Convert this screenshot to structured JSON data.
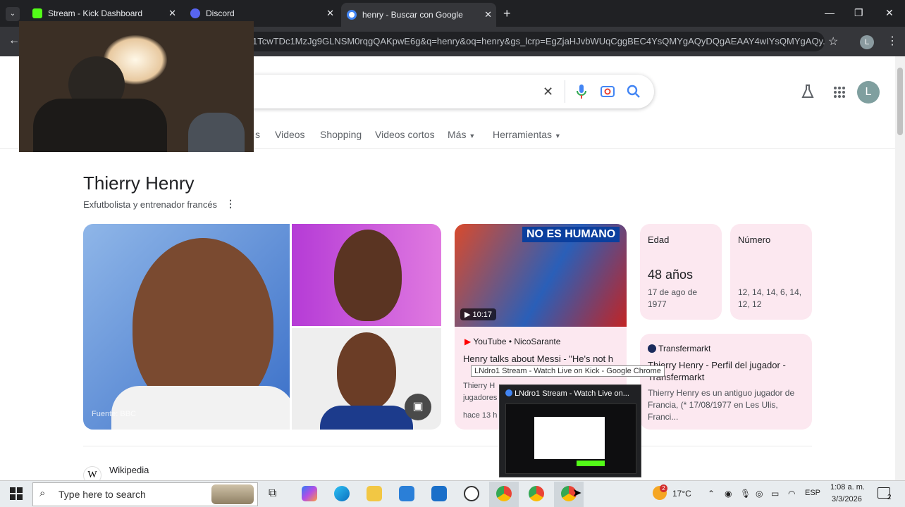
{
  "browser": {
    "tabs": [
      {
        "title": "Stream - Kick Dashboard",
        "favicon": "kick-icon",
        "color": "#53fc18"
      },
      {
        "title": "Discord",
        "favicon": "discord-icon",
        "color": "#5865f2"
      },
      {
        "title": "henry - Buscar con Google",
        "favicon": "google-icon",
        "color": "#ffffff"
      }
    ],
    "new_tab": "+",
    "close_glyph": "✕",
    "url": "1TcwTDc1MzJg9GLNSM0rqgQAKpwE6g&q=henry&oq=henry&gs_lcrp=EgZjaHJvbWUqCggBEC4YsQMYgAQyDQgAEAAY4wIYsQMYgAQy...",
    "profile_initial": "L",
    "window_controls": {
      "minimize": "—",
      "restore": "❐",
      "close": "✕"
    }
  },
  "search": {
    "close": "✕",
    "tabs": [
      "s",
      "Videos",
      "Shopping",
      "Videos cortos",
      "Más",
      "Herramientas"
    ],
    "profile_initial": "L"
  },
  "knowledge_panel": {
    "title": "Thierry Henry",
    "subtitle": "Exfutbolista y entrenador francés",
    "image_source": "Fuente: BBC",
    "video": {
      "thumbnail_text": "NO ES HUMANO",
      "duration": "10:17",
      "source": "YouTube • NicoSarante",
      "title": "Henry talks about Messi - \"He's not h",
      "snippet_1": "Thierry H",
      "snippet_2": "jugadores",
      "age": "hace 13 h"
    },
    "facts": [
      {
        "label": "Edad",
        "value": "48 años",
        "detail": "17 de ago de 1977"
      },
      {
        "label": "Número",
        "detail": "12, 14, 14, 6, 14, 12, 12"
      }
    ],
    "transfermarkt": {
      "source": "Transfermarkt",
      "title": "Thierry Henry - Perfil del jugador - Transfermarkt",
      "snippet": "Thierry Henry es un antiguo jugador de Francia, (* 17/08/1977 en Les Ulis, Franci..."
    },
    "wiki": {
      "source": "Wikipedia"
    }
  },
  "overlay": {
    "tooltip": "LNdro1 Stream - Watch Live on Kick - Google Chrome",
    "popup_title": "LNdro1 Stream - Watch Live on..."
  },
  "taskbar": {
    "search_placeholder": "Type here to search",
    "weather": "17°C",
    "weather_badge": "2",
    "lang": "ESP",
    "time": "1:08 a. m.",
    "date": "3/3/2026",
    "notifications": "2"
  }
}
